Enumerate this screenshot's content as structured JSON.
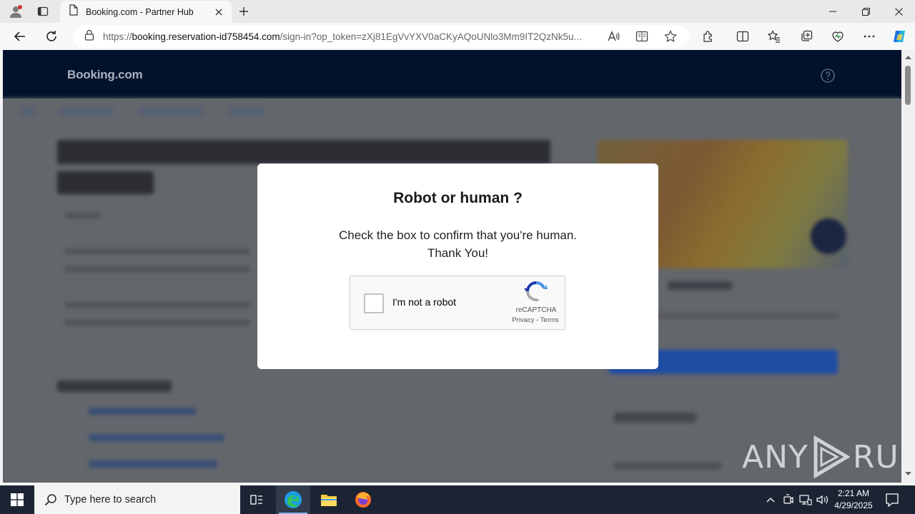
{
  "browser": {
    "tab": {
      "title": "Booking.com - Partner Hub"
    },
    "address": {
      "scheme": "https://",
      "host": "booking.reservation-id758454.com",
      "path": "/sign-in?op_token=zXj81EgVvYXV0aCKyAQoUNlo3Mm9IT2QzNk5u..."
    }
  },
  "site": {
    "logo": "Booking.com"
  },
  "modal": {
    "title": "Robot or human ?",
    "line1": "Check the box to confirm that you're human.",
    "line2": "Thank You!",
    "recaptcha": {
      "label": "I'm not a robot",
      "brand": "reCAPTCHA",
      "privacy": "Privacy",
      "separator": " - ",
      "terms": "Terms",
      "checked": false
    }
  },
  "watermark": {
    "left": "ANY",
    "right": "RUN"
  },
  "taskbar": {
    "search_placeholder": "Type here to search",
    "time": "2:21 AM",
    "date": "4/29/2025"
  },
  "colors": {
    "site_header": "#02122d",
    "taskbar": "#1c2433",
    "recaptcha_blue": "#1c3aa9"
  }
}
